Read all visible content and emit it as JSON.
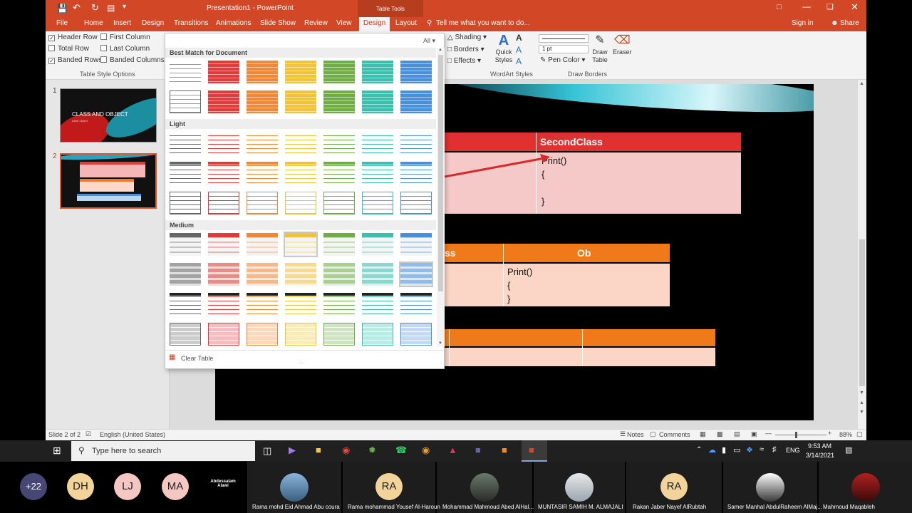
{
  "window": {
    "title": "Presentation1 - PowerPoint",
    "context_label": "Table Tools",
    "signin": "Sign in",
    "share": "Share"
  },
  "tabs": [
    "File",
    "Home",
    "Insert",
    "Design",
    "Transitions",
    "Animations",
    "Slide Show",
    "Review",
    "View",
    "Design",
    "Layout"
  ],
  "tell_me": "Tell me what you want to do...",
  "ribbon": {
    "options": {
      "header_row": "Header Row",
      "first_column": "First Column",
      "total_row": "Total Row",
      "last_column": "Last Column",
      "banded_rows": "Banded Rows",
      "banded_columns": "Banded Columns",
      "group": "Table Style Options"
    },
    "shading": "Shading",
    "borders": "Borders",
    "effects": "Effects",
    "quick_styles": "Quick Styles",
    "wordart_group": "WordArt Styles",
    "pen_weight": "1 pt",
    "pen_color": "Pen Color",
    "draw_table": "Draw Table",
    "eraser": "Eraser",
    "draw_borders_group": "Draw Borders"
  },
  "gallery": {
    "filter": "All",
    "sections": [
      "Best Match for Document",
      "Light",
      "Medium"
    ],
    "clear_table": "Clear Table",
    "colors": [
      "#666666",
      "#e03c3c",
      "#f0883a",
      "#f0c43a",
      "#70ad47",
      "#3cbfae",
      "#4a8fd8"
    ]
  },
  "slides": {
    "numbers": [
      "1",
      "2"
    ],
    "slide1_title": "CLASS AND OBJECT",
    "slide1_subtitle": "Abstr Object"
  },
  "slide": {
    "table1_header": "SecondClass",
    "table1_code": [
      "Print()",
      "{",
      "",
      "}"
    ],
    "table2_header_left": "ss",
    "table2_header_right": "Ob",
    "table2_code": [
      "Print()",
      "{",
      "}"
    ]
  },
  "status": {
    "slide": "Slide 2 of 2",
    "language": "English (United States)",
    "notes": "Notes",
    "comments": "Comments",
    "zoom": "88%"
  },
  "taskbar": {
    "search": "Type here to search",
    "lang": "ENG",
    "time": "9:53 AM",
    "date": "3/14/2021"
  },
  "participants": {
    "extra": "+22",
    "initials": [
      "DH",
      "LJ",
      "MA"
    ],
    "named": "Abdessalam Alawi",
    "tiles": [
      {
        "name": "Rama mohd Eid Ahmad Abu coura",
        "initials": ""
      },
      {
        "name": "Rama mohammad Yousef Al-Haroun",
        "initials": "RA"
      },
      {
        "name": "Mohammad Mahmoud Abed AlHal...",
        "initials": ""
      },
      {
        "name": "MUNTASIR SAMIH M. ALMAJALI",
        "initials": ""
      },
      {
        "name": "Rakan Jaber Nayef AlRubtah",
        "initials": "RA"
      },
      {
        "name": "Samer Manhal AbdulRaheem AlMaj...",
        "initials": ""
      },
      {
        "name": "Mahmoud Maqableh",
        "initials": ""
      }
    ]
  }
}
